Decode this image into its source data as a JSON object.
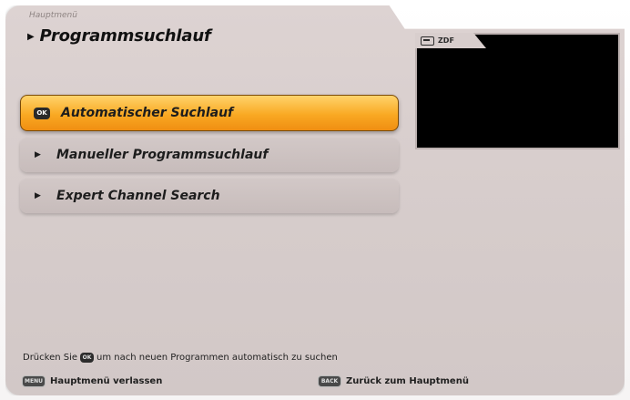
{
  "header": {
    "breadcrumb": "Hauptmenü",
    "title": "Programmsuchlauf",
    "title_arrow": "▶"
  },
  "menu": {
    "items": [
      {
        "label": "Automatischer Suchlauf",
        "key": "OK",
        "selected": true
      },
      {
        "label": "Manueller Programmsuchlauf",
        "bullet": "▶",
        "selected": false
      },
      {
        "label": "Expert Channel Search",
        "bullet": "▶",
        "selected": false
      }
    ]
  },
  "preview": {
    "channel": "ZDF",
    "icon": "tv-icon"
  },
  "hint": {
    "before": "Drücken Sie",
    "key": "OK",
    "after": "um nach neuen Programmen automatisch zu suchen"
  },
  "footer": {
    "left": {
      "key": "MENU",
      "label": "Hauptmenü verlassen"
    },
    "right": {
      "key": "BACK",
      "label": "Zurück zum Hauptmenü"
    }
  },
  "colors": {
    "panel": "#d8cecd",
    "selected_accent": "#f9a923",
    "preview_bg": "#000000"
  }
}
